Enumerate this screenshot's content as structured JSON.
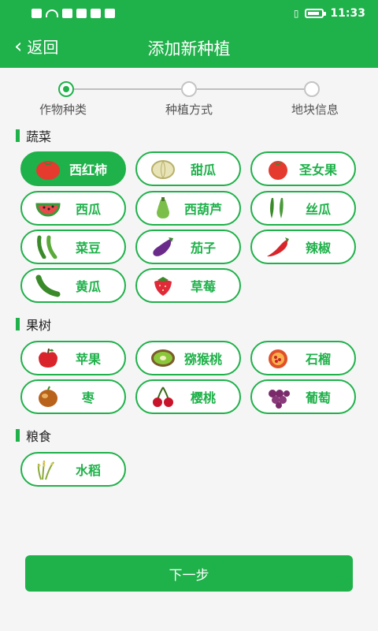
{
  "statusbar": {
    "time": "11:33"
  },
  "nav": {
    "back_label": "返回",
    "title": "添加新种植"
  },
  "steps": [
    {
      "label": "作物种类",
      "active": true
    },
    {
      "label": "种植方式",
      "active": false
    },
    {
      "label": "地块信息",
      "active": false
    }
  ],
  "sections": [
    {
      "title": "蔬菜",
      "items": [
        {
          "label": "西红柿",
          "icon": "tomato-icon",
          "selected": true
        },
        {
          "label": "甜瓜",
          "icon": "melon-icon"
        },
        {
          "label": "圣女果",
          "icon": "cherry-tomato-icon"
        },
        {
          "label": "西瓜",
          "icon": "watermelon-icon"
        },
        {
          "label": "西葫芦",
          "icon": "zucchini-icon"
        },
        {
          "label": "丝瓜",
          "icon": "luffa-icon"
        },
        {
          "label": "菜豆",
          "icon": "bean-icon"
        },
        {
          "label": "茄子",
          "icon": "eggplant-icon"
        },
        {
          "label": "辣椒",
          "icon": "chili-icon"
        },
        {
          "label": "黄瓜",
          "icon": "cucumber-icon"
        },
        {
          "label": "草莓",
          "icon": "strawberry-icon"
        }
      ]
    },
    {
      "title": "果树",
      "items": [
        {
          "label": "苹果",
          "icon": "apple-icon"
        },
        {
          "label": "猕猴桃",
          "icon": "kiwi-icon"
        },
        {
          "label": "石榴",
          "icon": "pomegranate-icon"
        },
        {
          "label": "枣",
          "icon": "jujube-icon"
        },
        {
          "label": "樱桃",
          "icon": "cherry-icon"
        },
        {
          "label": "葡萄",
          "icon": "grape-icon"
        }
      ]
    },
    {
      "title": "粮食",
      "items": [
        {
          "label": "水稻",
          "icon": "rice-icon"
        }
      ]
    }
  ],
  "footer": {
    "next_label": "下一步"
  },
  "colors": {
    "accent": "#1fb14a"
  }
}
